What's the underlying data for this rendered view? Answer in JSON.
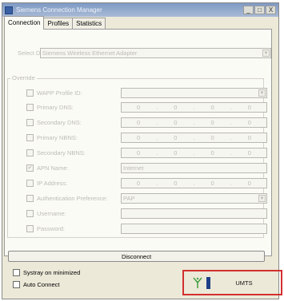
{
  "window": {
    "title": "Siemens Connection Manager",
    "controls": [
      "_",
      "□",
      "X"
    ]
  },
  "tabs": [
    "Connection",
    "Profiles",
    "Statistics"
  ],
  "device": {
    "label": "Select Device:",
    "value": "Siemens Wireless Ethernet Adapter"
  },
  "override": {
    "legend": "Override",
    "rows": {
      "wapp": {
        "label": "WAPP Profile ID:"
      },
      "primary_dns": {
        "label": "Primary DNS:",
        "octets": [
          "0",
          "0",
          "0",
          "0"
        ]
      },
      "secondary_dns": {
        "label": "Secondary DNS:",
        "octets": [
          "0",
          "0",
          "0",
          "0"
        ]
      },
      "primary_nbns": {
        "label": "Primary NBNS:",
        "octets": [
          "0",
          "0",
          "0",
          "0"
        ]
      },
      "secondary_nbns": {
        "label": "Secondary NBNS:",
        "octets": [
          "0",
          "0",
          "0",
          "0"
        ]
      },
      "apn": {
        "label": "APN Name:",
        "value": "Internet",
        "checkmark": "✔"
      },
      "ip": {
        "label": "IP Address:",
        "octets": [
          "0",
          "0",
          "0",
          "0"
        ]
      },
      "auth": {
        "label": "Authentication Preference:",
        "value": "PAP"
      },
      "username": {
        "label": "Username:"
      },
      "password": {
        "label": "Password:"
      }
    }
  },
  "disconnect_label": "Disconnect",
  "bottom": {
    "systray_label": "Systray on minimized",
    "autoconnect_label": "Auto Connect"
  },
  "status": {
    "network_type": "UMTS",
    "highlight_color": "#d32f2f",
    "signal_icon": "signal-antenna-icon"
  }
}
